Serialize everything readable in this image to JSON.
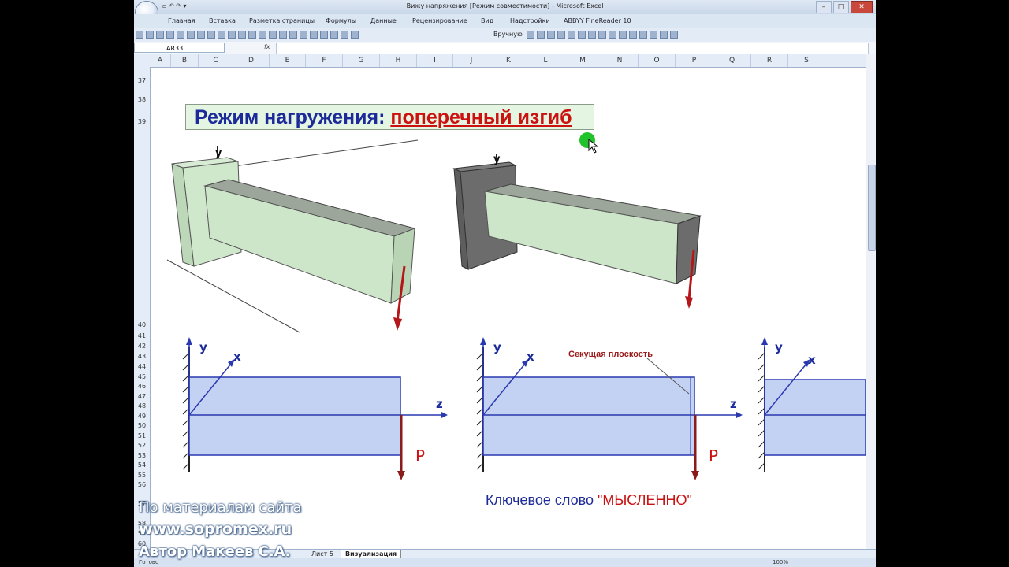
{
  "window": {
    "title": "Вижу напряжения  [Режим совместимости] - Microsoft Excel",
    "controls": {
      "minimize": "–",
      "maximize": "□",
      "close": "✕"
    }
  },
  "menu": [
    "Главная",
    "Вставка",
    "Разметка страницы",
    "Формулы",
    "Данные",
    "Рецензирование",
    "Вид",
    "Надстройки",
    "ABBYY FineReader 10"
  ],
  "toolbar": {
    "manual_label": "Вручную"
  },
  "formula_bar": {
    "name_box": "AR33",
    "fx": "fx",
    "value": ""
  },
  "columns": [
    "A",
    "B",
    "C",
    "D",
    "E",
    "F",
    "G",
    "H",
    "I",
    "J",
    "K",
    "L",
    "M",
    "N",
    "O",
    "P",
    "Q",
    "R",
    "S"
  ],
  "rows": [
    "37",
    "38",
    "39",
    "40",
    "41",
    "42",
    "43",
    "44",
    "45",
    "46",
    "47",
    "48",
    "49",
    "50",
    "51",
    "52",
    "53",
    "54",
    "55",
    "56",
    "57",
    "58",
    "59",
    "60"
  ],
  "headline": {
    "prefix": "Режим нагружения: ",
    "highlight": "поперечный изгиб"
  },
  "diagram": {
    "axis_y": "y",
    "axis_x": "x",
    "axis_z": "z",
    "force": "P",
    "cut_label": "Секущая плоскость"
  },
  "keyword": {
    "prefix": "Ключевое слово ",
    "highlight": "\"МЫСЛЕННО\""
  },
  "watermark": {
    "line1": "По материалам сайта",
    "line2": "www.sopromex.ru",
    "line3": "Автор Макеев С.А."
  },
  "sheets": [
    {
      "label": "Лист 5",
      "active": false
    },
    {
      "label": "Визуализация",
      "active": true
    }
  ],
  "status": {
    "ready": "Готово",
    "zoom": "100%"
  },
  "colors": {
    "beam_fill": "#c8e6c4",
    "beam_dark": "#a8a8a8",
    "force": "#c21a1a",
    "title_blue": "#1d2a9a",
    "accent_red": "#cc1111"
  }
}
